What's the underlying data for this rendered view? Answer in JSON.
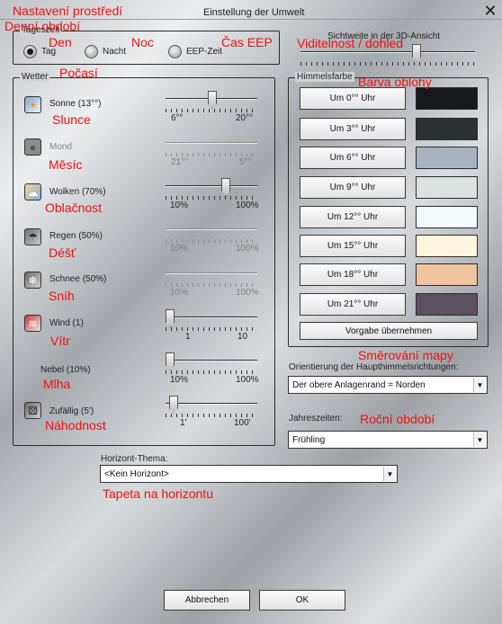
{
  "window": {
    "title": "Einstellung der Umwelt",
    "close_glyph": "✕"
  },
  "annotations": {
    "settings": "Nastavení prostředí",
    "daytime": "Denní období",
    "day": "Den",
    "night": "Noc",
    "eep_time": "Čas EEP",
    "visibility": "Viditelnost / dohled",
    "weather": "Počasí",
    "sky_color": "Barva oblohy",
    "sun": "Slunce",
    "moon": "Měsíc",
    "clouds": "Oblačnost",
    "rain": "Déšť",
    "snow": "Sníh",
    "wind": "Vítr",
    "fog": "Mlha",
    "random": "Náhodnost",
    "map_orientation": "Směrování mapy",
    "seasons": "Roční období",
    "horizon_wallpaper": "Tapeta na horizontu"
  },
  "tageszeit": {
    "legend": "Tageszeit",
    "options": [
      {
        "label": "Tag",
        "selected": true
      },
      {
        "label": "Nacht",
        "selected": false
      },
      {
        "label": "EEP-Zeit",
        "selected": false
      }
    ]
  },
  "sichtweite": {
    "label": "Sichtweite in der 3D-Ansicht",
    "level_fraction": 0.66
  },
  "wetter": {
    "legend": "Wetter",
    "items": [
      {
        "label": "Sonne (13°°)",
        "icon": "sun-icon",
        "enabled": true,
        "min": "6°°",
        "max": "20°°",
        "level_fraction": 0.5
      },
      {
        "label": "Mond",
        "icon": "moon-icon",
        "enabled": false,
        "min": "21°°",
        "max": "5°°",
        "level_fraction": null
      },
      {
        "label": "Wolken (70%)",
        "icon": "cloud-icon",
        "enabled": true,
        "min": "10%",
        "max": "100%",
        "level_fraction": 0.67
      },
      {
        "label": "Regen (50%)",
        "icon": "rain-icon",
        "enabled": true,
        "min": "10%",
        "max": "100%",
        "level_fraction": null
      },
      {
        "label": "Schnee (50%)",
        "icon": "snow-icon",
        "enabled": true,
        "min": "10%",
        "max": "100%",
        "level_fraction": null
      },
      {
        "label": "Wind (1)",
        "icon": "wind-icon",
        "enabled": true,
        "min": "1",
        "max": "10",
        "level_fraction": 0.0
      },
      {
        "label": "Nebel (10%)",
        "icon": "",
        "enabled": true,
        "min": "10%",
        "max": "100%",
        "level_fraction": 0.0
      },
      {
        "label": "Zufällig (5')",
        "icon": "dice-icon",
        "enabled": true,
        "min": "1'",
        "max": "100'",
        "level_fraction": 0.04
      }
    ]
  },
  "himmelsfarbe": {
    "legend": "Himmelsfarbe",
    "rows": [
      {
        "label": "Um 0°° Uhr",
        "color": "#18191c"
      },
      {
        "label": "Um 3°° Uhr",
        "color": "#2c3134"
      },
      {
        "label": "Um 6°° Uhr",
        "color": "#a9b2c0"
      },
      {
        "label": "Um 9°° Uhr",
        "color": "#dbe2e0"
      },
      {
        "label": "Um 12°° Uhr",
        "color": "#f3fbfc"
      },
      {
        "label": "Um 15°° Uhr",
        "color": "#fdf6df"
      },
      {
        "label": "Um 18°° Uhr",
        "color": "#efc49e"
      },
      {
        "label": "Um 21°° Uhr",
        "color": "#5b5161"
      }
    ],
    "default_button": "Vorgabe übernehmen"
  },
  "orientierung": {
    "label": "Orientierung der Haupthimmelsrichtungen:",
    "value": "Der obere Anlagenrand = Norden"
  },
  "jahreszeiten": {
    "label": "Jahreszeiten:",
    "value": "Frühling"
  },
  "horizont": {
    "label": "Horizont-Thema:",
    "value": "<Kein Horizont>"
  },
  "buttons": {
    "cancel": "Abbrechen",
    "ok": "OK"
  }
}
